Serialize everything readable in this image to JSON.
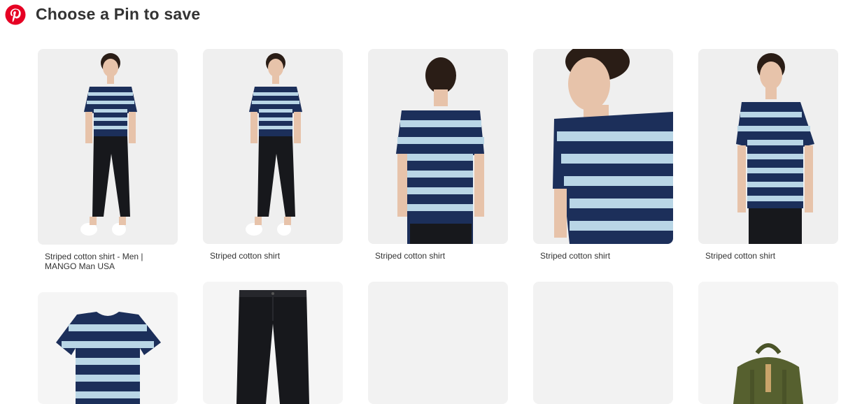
{
  "header": {
    "title": "Choose a Pin to save",
    "logo_icon": "pinterest-logo-icon",
    "brand_color": "#E60023"
  },
  "pins": [
    {
      "caption": "Striped cotton shirt - Men | MANGO Man USA",
      "image": "man-full-body-striped-tee-black-pants"
    },
    {
      "caption": "Striped cotton shirt",
      "image": "man-full-body-striped-tee-black-pants"
    },
    {
      "caption": "Striped cotton shirt",
      "image": "man-back-view-striped-tee"
    },
    {
      "caption": "Striped cotton shirt",
      "image": "man-side-profile-closeup-striped-tee"
    },
    {
      "caption": "Striped cotton shirt",
      "image": "man-front-half-body-striped-tee"
    },
    {
      "caption": "",
      "image": "striped-tee-product-flat"
    },
    {
      "caption": "",
      "image": "black-jeans-product"
    },
    {
      "caption": "",
      "image": "blank-placeholder"
    },
    {
      "caption": "",
      "image": "blank-placeholder"
    },
    {
      "caption": "",
      "image": "olive-canvas-backpack"
    }
  ],
  "colors": {
    "navy_stripe": "#1c2f5a",
    "light_stripe": "#b9d6e6",
    "pants": "#17181c",
    "skin": "#e7c3aa",
    "hair": "#2a1d16",
    "placeholder": "#f2f2f2",
    "backpack": "#56602f"
  }
}
